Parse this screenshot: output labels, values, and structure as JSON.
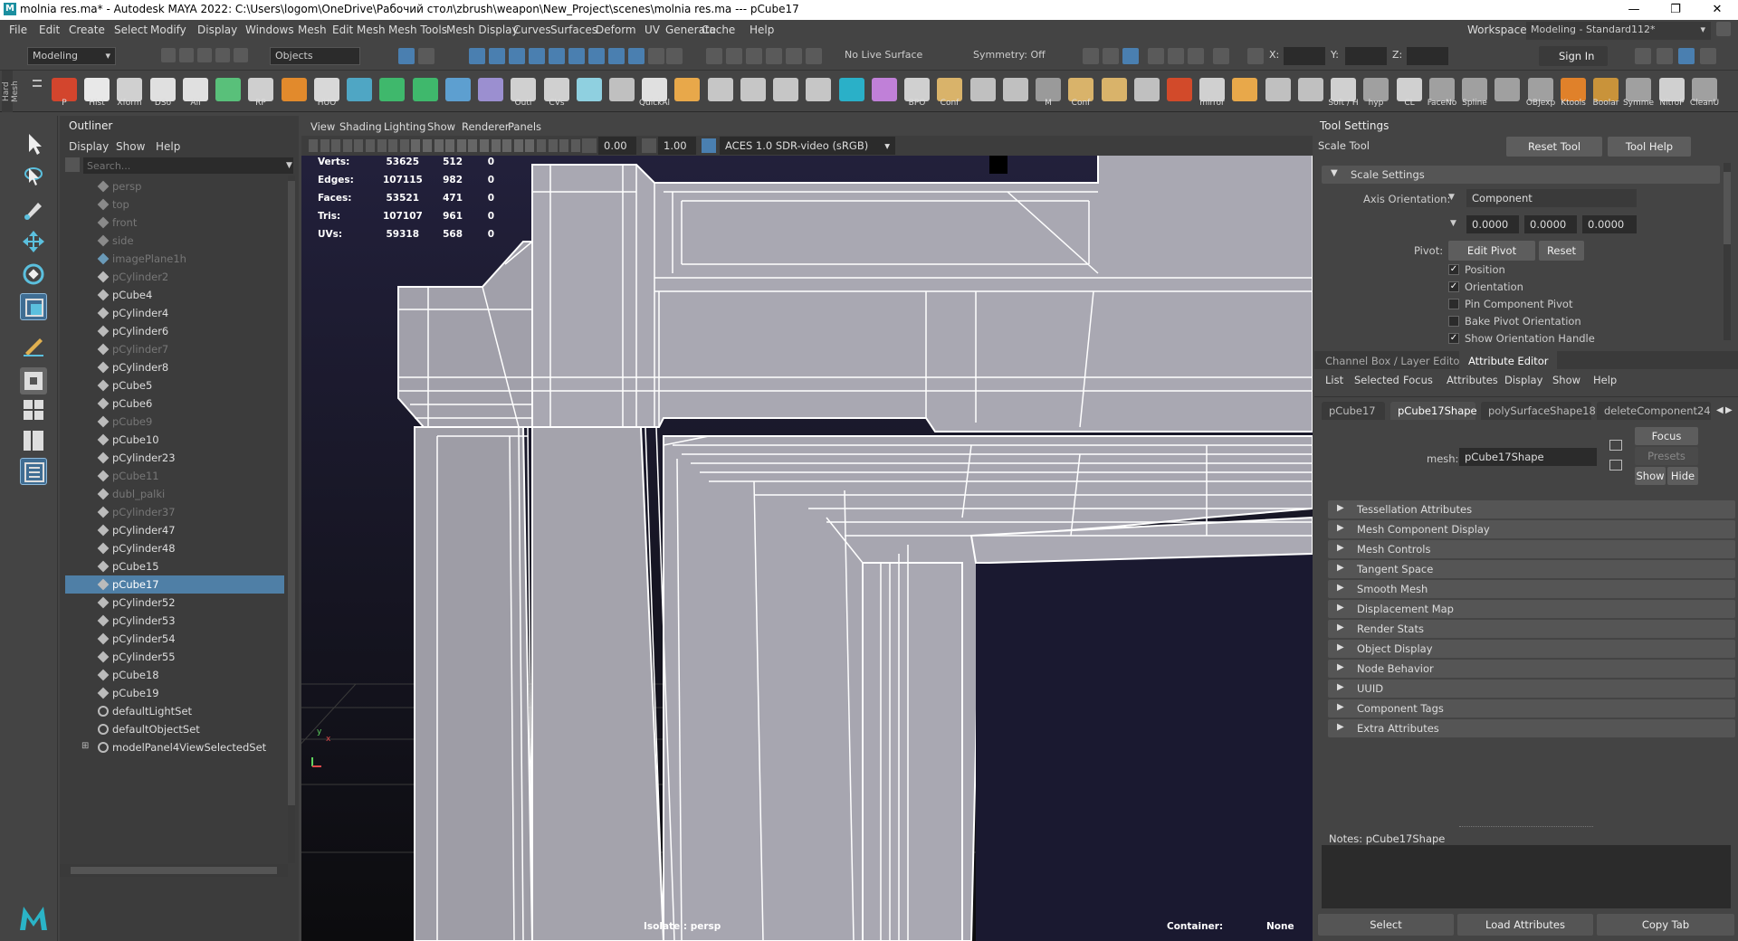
{
  "window": {
    "title": "molnia res.ma* - Autodesk MAYA 2022: C:\\Users\\logom\\OneDrive\\Рабочий стол\\zbrush\\weapon\\New_Project\\scenes\\molnia res.ma  ---  pCube17",
    "minimize": "—",
    "maximize": "❐",
    "close": "✕"
  },
  "menubar": [
    "File",
    "Edit",
    "Create",
    "Select",
    "Modify",
    "Display",
    "Windows",
    "Mesh",
    "Edit Mesh",
    "Mesh Tools",
    "Mesh Display",
    "Curves",
    "Surfaces",
    "Deform",
    "UV",
    "Generate",
    "Cache",
    "Help"
  ],
  "workspace": {
    "label": "Workspace :",
    "value": "Modeling - Standard112*"
  },
  "statusline": {
    "menuset": "Modeling",
    "objects_label": "Objects",
    "live_surface": "No Live Surface",
    "symmetry": "Symmetry: Off",
    "x_label": "X:",
    "y_label": "Y:",
    "z_label": "Z:",
    "sign_in": "Sign In"
  },
  "sidebar_vertical_label": "Hard Mesh",
  "shelf": [
    {
      "label": "P",
      "color": "#d3452d"
    },
    {
      "label": "Hist",
      "color": "#e8e8e8"
    },
    {
      "label": "Xform",
      "color": "#d0d0d0"
    },
    {
      "label": "DSo",
      "color": "#e0e0e0"
    },
    {
      "label": "All",
      "color": "#e0e0e0"
    },
    {
      "label": "",
      "color": "#59c07a"
    },
    {
      "label": "RP",
      "color": "#cfcfcf"
    },
    {
      "label": "",
      "color": "#e28a2c"
    },
    {
      "label": "HUO",
      "color": "#d8d8d8"
    },
    {
      "label": "",
      "color": "#4fa6c4"
    },
    {
      "label": "",
      "color": "#3fb86c"
    },
    {
      "label": "",
      "color": "#3fb86c"
    },
    {
      "label": "",
      "color": "#5d9fd0"
    },
    {
      "label": "",
      "color": "#9b8fd0"
    },
    {
      "label": "Outl",
      "color": "#d0d0d0"
    },
    {
      "label": "CVs",
      "color": "#d0d0d0"
    },
    {
      "label": "",
      "color": "#8fd0e0"
    },
    {
      "label": "",
      "color": "#c0c0c0"
    },
    {
      "label": "QuickAl",
      "color": "#e0e0e0"
    },
    {
      "label": "",
      "color": "#e8a84a"
    },
    {
      "label": "",
      "color": "#c6c6c6"
    },
    {
      "label": "",
      "color": "#c6c6c6"
    },
    {
      "label": "",
      "color": "#c6c6c6"
    },
    {
      "label": "",
      "color": "#c6c6c6"
    },
    {
      "label": "",
      "color": "#2ab0c8"
    },
    {
      "label": "",
      "color": "#c080d8"
    },
    {
      "label": "BPO",
      "color": "#d0d0d0"
    },
    {
      "label": "Conf",
      "color": "#d9b36a"
    },
    {
      "label": "",
      "color": "#c0c0c0"
    },
    {
      "label": "",
      "color": "#c0c0c0"
    },
    {
      "label": "M",
      "color": "#9a9a9a"
    },
    {
      "label": "Conf",
      "color": "#d9b36a"
    },
    {
      "label": "",
      "color": "#d9b36a"
    },
    {
      "label": "",
      "color": "#c0c0c0"
    },
    {
      "label": "",
      "color": "#d24a2a"
    },
    {
      "label": "mirror",
      "color": "#d0d0d0"
    },
    {
      "label": "",
      "color": "#e8a84a"
    },
    {
      "label": "",
      "color": "#c0c0c0"
    },
    {
      "label": "",
      "color": "#c0c0c0"
    },
    {
      "label": "Soft / H",
      "color": "#d0d0d0"
    },
    {
      "label": "hyp",
      "color": "#a0a0a0"
    },
    {
      "label": "CL",
      "color": "#d0d0d0"
    },
    {
      "label": "FaceNo",
      "color": "#a0a0a0"
    },
    {
      "label": "Spline",
      "color": "#a0a0a0"
    },
    {
      "label": "",
      "color": "#a0a0a0"
    },
    {
      "label": "OBJexp",
      "color": "#a0a0a0"
    },
    {
      "label": "Ktools",
      "color": "#e0812a"
    },
    {
      "label": "Boolar",
      "color": "#c9933a"
    },
    {
      "label": "Symme",
      "color": "#a0a0a0"
    },
    {
      "label": "NitroP",
      "color": "#d0d0d0"
    },
    {
      "label": "CleanU",
      "color": "#a0a0a0"
    }
  ],
  "outliner": {
    "title": "Outliner",
    "menu": [
      "Display",
      "Show",
      "Help"
    ],
    "search_placeholder": "Search...",
    "items": [
      {
        "label": "persp",
        "dim": true,
        "icon": "camera"
      },
      {
        "label": "top",
        "dim": true,
        "icon": "camera"
      },
      {
        "label": "front",
        "dim": true,
        "icon": "camera"
      },
      {
        "label": "side",
        "dim": true,
        "icon": "camera"
      },
      {
        "label": "imagePlane1h",
        "dim": true,
        "icon": "image"
      },
      {
        "label": "pCylinder2",
        "dim": true,
        "icon": "mesh"
      },
      {
        "label": "pCube4",
        "dim": false,
        "icon": "mesh"
      },
      {
        "label": "pCylinder4",
        "dim": false,
        "icon": "mesh"
      },
      {
        "label": "pCylinder6",
        "dim": false,
        "icon": "mesh"
      },
      {
        "label": "pCylinder7",
        "dim": true,
        "icon": "mesh"
      },
      {
        "label": "pCylinder8",
        "dim": false,
        "icon": "mesh"
      },
      {
        "label": "pCube5",
        "dim": false,
        "icon": "mesh"
      },
      {
        "label": "pCube6",
        "dim": false,
        "icon": "mesh"
      },
      {
        "label": "pCube9",
        "dim": true,
        "icon": "mesh"
      },
      {
        "label": "pCube10",
        "dim": false,
        "icon": "mesh"
      },
      {
        "label": "pCylinder23",
        "dim": false,
        "icon": "mesh"
      },
      {
        "label": "pCube11",
        "dim": true,
        "icon": "mesh"
      },
      {
        "label": "dubl_palki",
        "dim": true,
        "icon": "mesh"
      },
      {
        "label": "pCylinder37",
        "dim": true,
        "icon": "mesh"
      },
      {
        "label": "pCylinder47",
        "dim": false,
        "icon": "mesh"
      },
      {
        "label": "pCylinder48",
        "dim": false,
        "icon": "mesh"
      },
      {
        "label": "pCube15",
        "dim": false,
        "icon": "mesh"
      },
      {
        "label": "pCube17",
        "dim": false,
        "icon": "mesh",
        "selected": true
      },
      {
        "label": "pCylinder52",
        "dim": false,
        "icon": "mesh"
      },
      {
        "label": "pCylinder53",
        "dim": false,
        "icon": "mesh"
      },
      {
        "label": "pCylinder54",
        "dim": false,
        "icon": "mesh"
      },
      {
        "label": "pCylinder55",
        "dim": false,
        "icon": "mesh"
      },
      {
        "label": "pCube18",
        "dim": false,
        "icon": "mesh"
      },
      {
        "label": "pCube19",
        "dim": false,
        "icon": "mesh"
      },
      {
        "label": "defaultLightSet",
        "dim": false,
        "icon": "set"
      },
      {
        "label": "defaultObjectSet",
        "dim": false,
        "icon": "set"
      },
      {
        "label": "modelPanel4ViewSelectedSet",
        "dim": false,
        "icon": "set",
        "expand": true
      }
    ]
  },
  "viewport": {
    "menu": [
      "View",
      "Shading",
      "Lighting",
      "Show",
      "Renderer",
      "Panels"
    ],
    "exposure": "0.00",
    "gamma": "1.00",
    "colorspace": "ACES 1.0 SDR-video (sRGB)",
    "hud": [
      {
        "label": "Verts:",
        "v1": "53625",
        "v2": "512",
        "v3": "0"
      },
      {
        "label": "Edges:",
        "v1": "107115",
        "v2": "982",
        "v3": "0"
      },
      {
        "label": "Faces:",
        "v1": "53521",
        "v2": "471",
        "v3": "0"
      },
      {
        "label": "Tris:",
        "v1": "107107",
        "v2": "961",
        "v3": "0"
      },
      {
        "label": "UVs:",
        "v1": "59318",
        "v2": "568",
        "v3": "0"
      }
    ],
    "isolate": "Isolate : persp",
    "container_label": "Container:",
    "container_value": "None",
    "axis_y": "y",
    "axis_x": "x",
    "bg_color": "#1c1a33",
    "mesh_color": "#a8a7b1"
  },
  "tool_settings": {
    "title": "Tool Settings",
    "tool_name": "Scale Tool",
    "reset_tool": "Reset Tool",
    "tool_help": "Tool Help",
    "section": "Scale Settings",
    "axis_orientation_label": "Axis Orientation:",
    "axis_orientation_value": "Component",
    "vals": [
      "0.0000",
      "0.0000",
      "0.0000"
    ],
    "pivot_label": "Pivot:",
    "edit_pivot": "Edit Pivot",
    "reset": "Reset",
    "checks": [
      {
        "label": "Position",
        "checked": true
      },
      {
        "label": "Orientation",
        "checked": true
      },
      {
        "label": "Pin Component Pivot",
        "checked": false
      },
      {
        "label": "Bake Pivot Orientation",
        "checked": false
      },
      {
        "label": "Show Orientation Handle",
        "checked": true
      }
    ]
  },
  "attr_editor": {
    "tab_channel": "Channel Box / Layer Editor",
    "tab_attr": "Attribute Editor",
    "menu": [
      "List",
      "Selected",
      "Focus",
      "Attributes",
      "Display",
      "Show",
      "Help"
    ],
    "node_tabs": [
      "pCube17",
      "pCube17Shape",
      "polySurfaceShape18",
      "deleteComponent24"
    ],
    "focus": "Focus",
    "presets": "Presets",
    "show": "Show",
    "hide": "Hide",
    "mesh_label": "mesh:",
    "mesh_value": "pCube17Shape",
    "sections": [
      "Tessellation Attributes",
      "Mesh Component Display",
      "Mesh Controls",
      "Tangent Space",
      "Smooth Mesh",
      "Displacement Map",
      "Render Stats",
      "Object Display",
      "Node Behavior",
      "UUID",
      "Component Tags",
      "Extra Attributes"
    ],
    "notes": "Notes:  pCube17Shape",
    "select": "Select",
    "load": "Load Attributes",
    "copy": "Copy Tab"
  }
}
